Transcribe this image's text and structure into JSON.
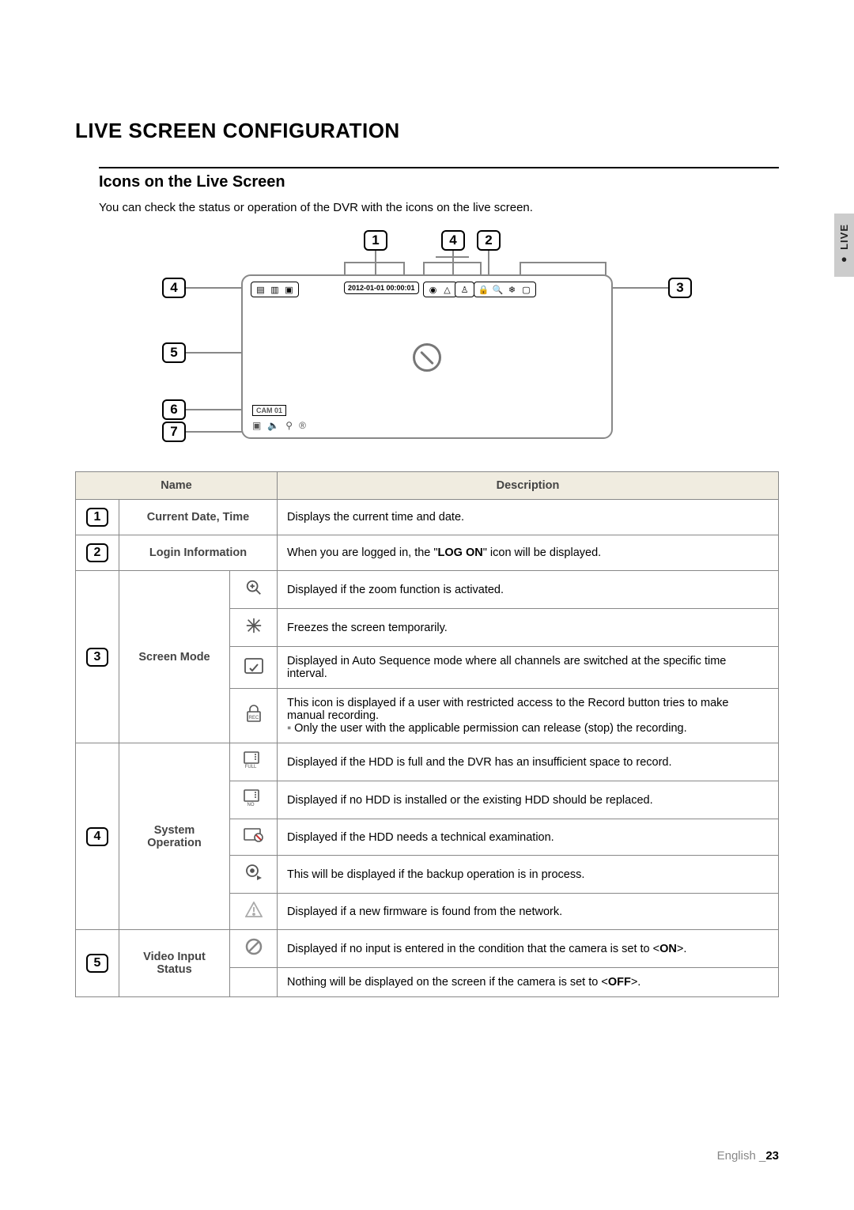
{
  "side_tab": "● LIVE",
  "heading": "LIVE SCREEN CONFIGURATION",
  "subheading": "Icons on the Live Screen",
  "intro": "You can check the status or operation of the DVR with the icons on the live screen.",
  "diagram": {
    "callouts_top": [
      "1",
      "4",
      "2"
    ],
    "callouts_left": [
      "4",
      "5",
      "6",
      "7"
    ],
    "callout_right": "3",
    "datetime": "2012-01-01  00:00:01",
    "cam_label": "CAM 01"
  },
  "table": {
    "headers": {
      "name": "Name",
      "description": "Description"
    },
    "rows": [
      {
        "num": "1",
        "name": "Current Date, Time",
        "desc": "Displays the current time and date."
      },
      {
        "num": "2",
        "name": "Login Information",
        "desc_pre": "When you are logged in, the \"",
        "desc_bold": "LOG ON",
        "desc_post": "\" icon will be displayed."
      },
      {
        "num": "3",
        "name": "Screen Mode",
        "sub": [
          {
            "icon": "zoom-icon",
            "desc": "Displayed if the zoom function is activated."
          },
          {
            "icon": "freeze-icon",
            "desc": "Freezes the screen temporarily."
          },
          {
            "icon": "autoseq-icon",
            "desc": "Displayed in Auto Sequence mode where all channels are switched at the specific time interval."
          },
          {
            "icon": "rec-lock-icon",
            "desc": "This icon is displayed if a user with restricted access to the Record button tries to make manual recording.",
            "note": "Only the user with the applicable permission can release (stop) the recording."
          }
        ]
      },
      {
        "num": "4",
        "name": "System Operation",
        "sub": [
          {
            "icon": "hdd-full-icon",
            "desc": "Displayed if the HDD is full and the DVR has an insufficient space to record."
          },
          {
            "icon": "no-hdd-icon",
            "desc": "Displayed if no HDD is installed or the existing HDD should be replaced."
          },
          {
            "icon": "hdd-fail-icon",
            "desc": "Displayed if the HDD needs a technical examination."
          },
          {
            "icon": "backup-icon",
            "desc": "This will be displayed if the backup operation is in process."
          },
          {
            "icon": "firmware-icon",
            "desc": "Displayed if a new firmware is found from the network."
          }
        ]
      },
      {
        "num": "5",
        "name": "Video Input Status",
        "sub": [
          {
            "icon": "no-input-icon",
            "desc_pre": "Displayed if no input is entered in the condition that the camera is set to <",
            "desc_bold": "ON",
            "desc_post": ">."
          },
          {
            "icon": "",
            "desc_pre": "Nothing will be displayed on the screen if the camera is set to <",
            "desc_bold": "OFF",
            "desc_post": ">."
          }
        ]
      }
    ]
  },
  "footer": {
    "lang": "English",
    "sep": "_",
    "page": "23"
  }
}
